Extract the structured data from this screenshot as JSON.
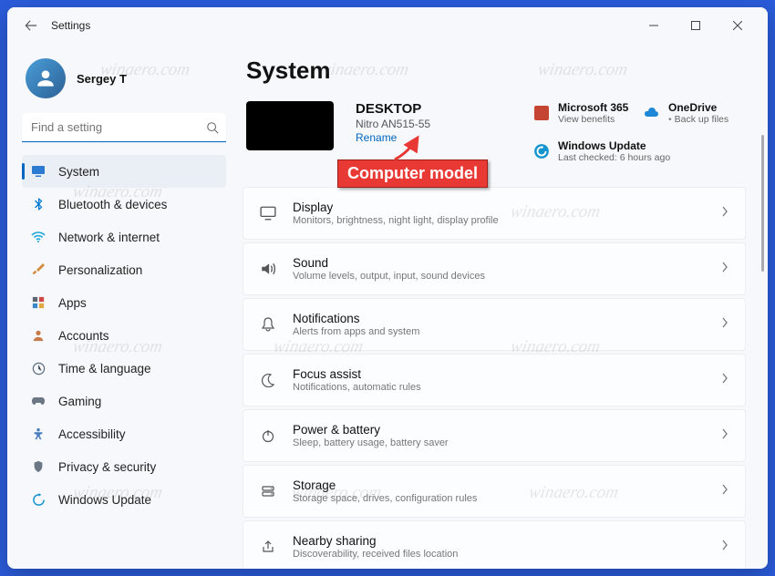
{
  "window": {
    "title": "Settings"
  },
  "user": {
    "name": "Sergey T"
  },
  "search": {
    "placeholder": "Find a setting"
  },
  "sidebar": {
    "items": [
      {
        "label": "System",
        "icon": "display",
        "active": true
      },
      {
        "label": "Bluetooth & devices",
        "icon": "bluetooth",
        "active": false
      },
      {
        "label": "Network & internet",
        "icon": "wifi",
        "active": false
      },
      {
        "label": "Personalization",
        "icon": "brush",
        "active": false
      },
      {
        "label": "Apps",
        "icon": "grid",
        "active": false
      },
      {
        "label": "Accounts",
        "icon": "person",
        "active": false
      },
      {
        "label": "Time & language",
        "icon": "clock-globe",
        "active": false
      },
      {
        "label": "Gaming",
        "icon": "gamepad",
        "active": false
      },
      {
        "label": "Accessibility",
        "icon": "accessibility",
        "active": false
      },
      {
        "label": "Privacy & security",
        "icon": "shield",
        "active": false
      },
      {
        "label": "Windows Update",
        "icon": "update",
        "active": false
      }
    ]
  },
  "page": {
    "title": "System",
    "pc": {
      "name": "DESKTOP",
      "model": "Nitro AN515-55",
      "rename_label": "Rename"
    },
    "tiles": {
      "m365_title": "Microsoft 365",
      "m365_sub": "View benefits",
      "onedrive_title": "OneDrive",
      "onedrive_sub": "Back up files",
      "update_title": "Windows Update",
      "update_sub": "Last checked: 6 hours ago"
    },
    "cards": [
      {
        "icon": "display",
        "title": "Display",
        "sub": "Monitors, brightness, night light, display profile"
      },
      {
        "icon": "sound",
        "title": "Sound",
        "sub": "Volume levels, output, input, sound devices"
      },
      {
        "icon": "bell",
        "title": "Notifications",
        "sub": "Alerts from apps and system"
      },
      {
        "icon": "moon",
        "title": "Focus assist",
        "sub": "Notifications, automatic rules"
      },
      {
        "icon": "power",
        "title": "Power & battery",
        "sub": "Sleep, battery usage, battery saver"
      },
      {
        "icon": "storage",
        "title": "Storage",
        "sub": "Storage space, drives, configuration rules"
      },
      {
        "icon": "share",
        "title": "Nearby sharing",
        "sub": "Discoverability, received files location"
      }
    ]
  },
  "callout": {
    "text": "Computer model"
  },
  "watermark": "winaero.com"
}
